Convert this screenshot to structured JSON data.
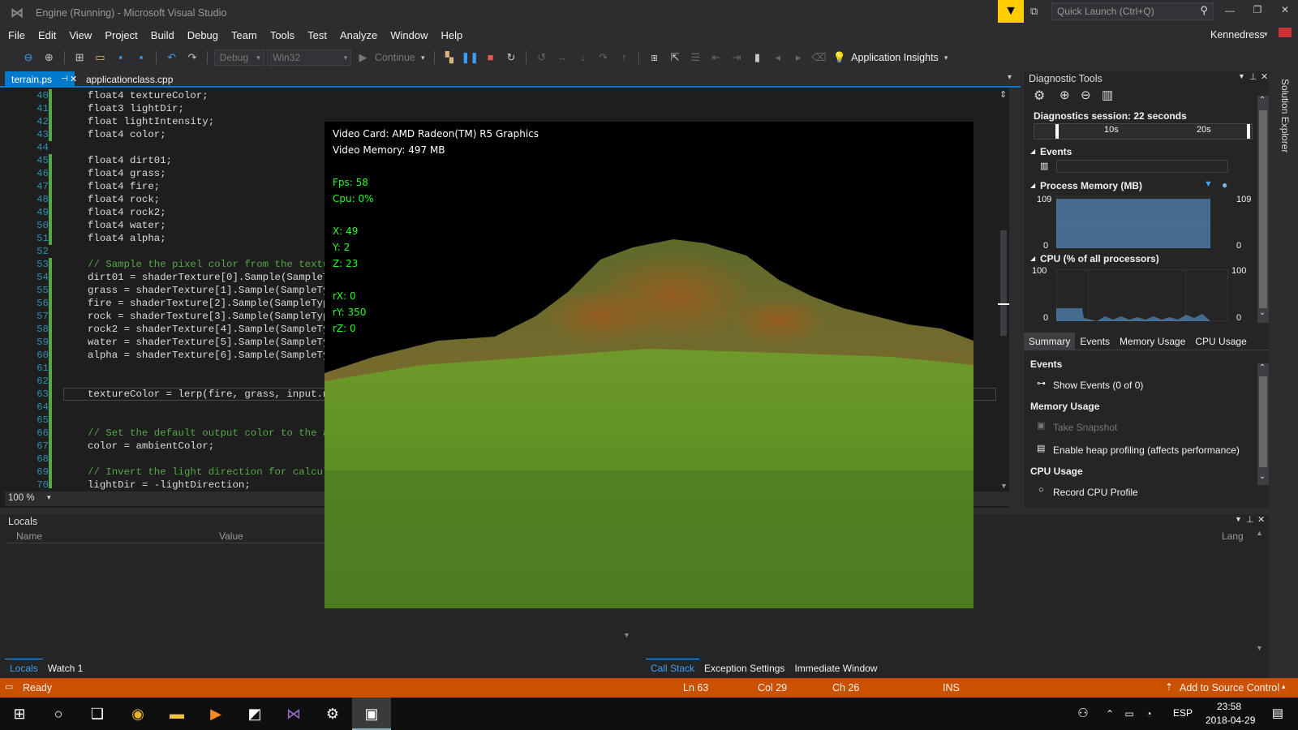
{
  "window": {
    "title": "Engine (Running) - Microsoft Visual Studio",
    "quick_launch_placeholder": "Quick Launch (Ctrl+Q)",
    "user": "Kennedress"
  },
  "menu": [
    "File",
    "Edit",
    "View",
    "Project",
    "Build",
    "Debug",
    "Team",
    "Tools",
    "Test",
    "Analyze",
    "Window",
    "Help"
  ],
  "toolbar": {
    "config": "Debug",
    "platform": "Win32",
    "continue_label": "Continue",
    "app_insights": "Application Insights"
  },
  "tabs": [
    {
      "label": "terrain.ps"
    },
    {
      "label": "applicationclass.cpp"
    }
  ],
  "code": [
    {
      "ln": "40",
      "text": "float4 textureColor;"
    },
    {
      "ln": "41",
      "text": "float3 lightDir;"
    },
    {
      "ln": "42",
      "text": "float lightIntensity;"
    },
    {
      "ln": "43",
      "text": "float4 color;"
    },
    {
      "ln": "44",
      "text": ""
    },
    {
      "ln": "45",
      "text": "float4 dirt01;"
    },
    {
      "ln": "46",
      "text": "float4 grass;"
    },
    {
      "ln": "47",
      "text": "float4 fire;"
    },
    {
      "ln": "48",
      "text": "float4 rock;"
    },
    {
      "ln": "49",
      "text": "float4 rock2;"
    },
    {
      "ln": "50",
      "text": "float4 water;"
    },
    {
      "ln": "51",
      "text": "float4 alpha;"
    },
    {
      "ln": "52",
      "text": ""
    },
    {
      "ln": "53",
      "text": "// Sample the pixel color from the texture"
    },
    {
      "ln": "54",
      "text": "dirt01 = shaderTexture[0].Sample(SampleTyp"
    },
    {
      "ln": "55",
      "text": "grass = shaderTexture[1].Sample(SampleType"
    },
    {
      "ln": "56",
      "text": "fire = shaderTexture[2].Sample(SampleType,"
    },
    {
      "ln": "57",
      "text": "rock = shaderTexture[3].Sample(SampleType,"
    },
    {
      "ln": "58",
      "text": "rock2 = shaderTexture[4].Sample(SampleType"
    },
    {
      "ln": "59",
      "text": "water = shaderTexture[5].Sample(SampleType"
    },
    {
      "ln": "60",
      "text": "alpha = shaderTexture[6].Sample(SampleType"
    },
    {
      "ln": "61",
      "text": ""
    },
    {
      "ln": "62",
      "text": ""
    },
    {
      "ln": "63",
      "text": "textureColor = lerp(fire, grass, input.nor"
    },
    {
      "ln": "64",
      "text": ""
    },
    {
      "ln": "65",
      "text": ""
    },
    {
      "ln": "66",
      "text": "// Set the default output color to the amb"
    },
    {
      "ln": "67",
      "text": "color = ambientColor;"
    },
    {
      "ln": "68",
      "text": ""
    },
    {
      "ln": "69",
      "text": "// Invert the light direction for calculat"
    },
    {
      "ln": "70",
      "text": "lightDir = -lightDirection;"
    }
  ],
  "zoom": "100 %",
  "overlay": {
    "video_card": "Video Card: AMD Radeon(TM) R5 Graphics",
    "video_memory": "Video Memory: 497 MB",
    "fps": "Fps: 58",
    "cpu": "Cpu: 0%",
    "x": "X: 49",
    "y": "Y: 2",
    "z": "Z: 23",
    "rx": "rX: 0",
    "ry": "rY: 350",
    "rz": "rZ: 0"
  },
  "diag": {
    "title": "Diagnostic Tools",
    "session": "Diagnostics session: 22 seconds",
    "t10": "10s",
    "t20": "20s",
    "events": "Events",
    "memory": "Process Memory (MB)",
    "mem_max": "109",
    "mem_min": "0",
    "cpu": "CPU (% of all processors)",
    "cpu_max": "100",
    "cpu_min": "0",
    "tabs": [
      "Summary",
      "Events",
      "Memory Usage",
      "CPU Usage"
    ],
    "events_hdr": "Events",
    "show_events": "Show Events (0 of 0)",
    "mem_hdr": "Memory Usage",
    "snapshot": "Take Snapshot",
    "heap": "Enable heap profiling (affects performance)",
    "cpu_hdr": "CPU Usage",
    "record": "Record CPU Profile",
    "memory_level": 0.95
  },
  "solution_explorer": "Solution Explorer",
  "locals": {
    "title": "Locals",
    "col_name": "Name",
    "col_value": "Value",
    "tab_locals": "Locals",
    "tab_watch": "Watch 1"
  },
  "callstack": {
    "col_lang": "Lang",
    "tabs": [
      "Call Stack",
      "Exception Settings",
      "Immediate Window"
    ]
  },
  "status": {
    "ready": "Ready",
    "ln": "Ln 63",
    "col": "Col 29",
    "ch": "Ch 26",
    "ins": "INS",
    "source": "Add to Source Control"
  },
  "taskbar": {
    "lang": "ESP",
    "time": "23:58",
    "date": "2018-04-29"
  },
  "colors": {
    "accent": "#007acc",
    "status": "#ca5100",
    "bg": "#2d2d30",
    "editor": "#1e1e1e"
  }
}
